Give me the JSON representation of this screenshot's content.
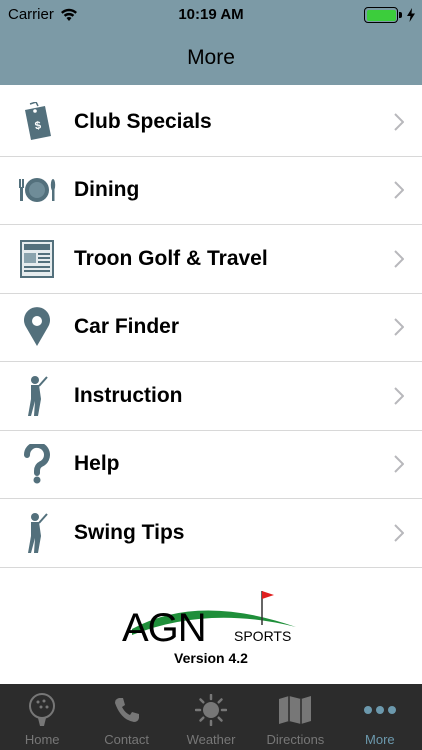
{
  "status_bar": {
    "carrier": "Carrier",
    "time": "10:19 AM",
    "battery_color": "#3ccd3c"
  },
  "header": {
    "title": "More",
    "background": "#7c9aa6"
  },
  "menu": {
    "items": [
      {
        "label": "Club Specials",
        "icon": "price-tag-icon"
      },
      {
        "label": "Dining",
        "icon": "plate-cutlery-icon"
      },
      {
        "label": "Troon Golf & Travel",
        "icon": "newspaper-icon"
      },
      {
        "label": "Car Finder",
        "icon": "map-pin-icon"
      },
      {
        "label": "Instruction",
        "icon": "golfer-icon"
      },
      {
        "label": "Help",
        "icon": "question-mark-icon"
      },
      {
        "label": "Swing Tips",
        "icon": "golfer-icon"
      }
    ]
  },
  "footer": {
    "logo_text": "AGN",
    "logo_subtext": "SPORTS",
    "version": "Version 4.2"
  },
  "tab_bar": {
    "tabs": [
      {
        "label": "Home",
        "icon": "golf-ball-icon",
        "active": false
      },
      {
        "label": "Contact",
        "icon": "phone-icon",
        "active": false
      },
      {
        "label": "Weather",
        "icon": "sun-icon",
        "active": false
      },
      {
        "label": "Directions",
        "icon": "map-icon",
        "active": false
      },
      {
        "label": "More",
        "icon": "more-dots-icon",
        "active": true
      }
    ],
    "active_color": "#6c99ad"
  }
}
